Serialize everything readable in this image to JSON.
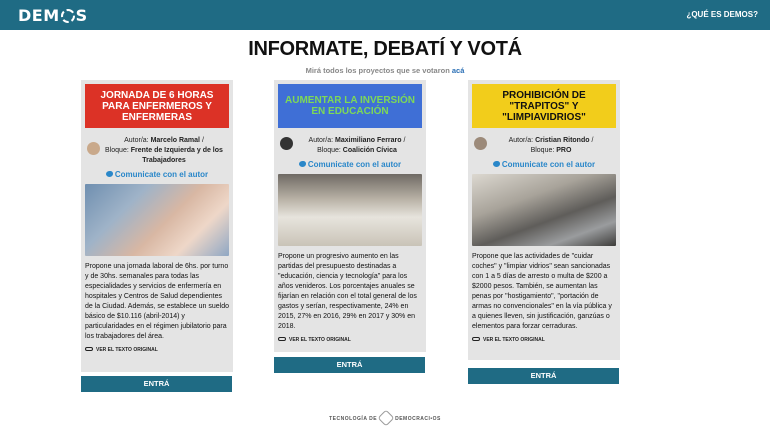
{
  "header": {
    "logo": "DEMOS",
    "logo_parts": [
      "DE",
      "M",
      "S"
    ],
    "whatis": "¿QUÉ ES DEMOS?"
  },
  "headline": "INFORMATE, DEBATÍ Y VOTÁ",
  "subline": {
    "text": "Mirá todos los proyectos que se votaron ",
    "link": "acá"
  },
  "cards": [
    {
      "title": "JORNADA DE 6 HORAS PARA ENFERMEROS Y ENFERMERAS",
      "title_bg": "#dc3226",
      "title_color": "#ffffff",
      "author_prefix": "Autor/a: ",
      "author_name": "Marcelo Ramal",
      "bloc_prefix": "Bloque: ",
      "bloc_name": "Frente de Izquierda y de los Trabajadores",
      "contact": "Comunicate con el autor",
      "description": "Propone una jornada laboral de 6hs. por turno y de 30hs. semanales para todas las especialidades y servicios de enfermería en hospitales y Centros de Salud dependientes de la Ciudad. Además, se establece un sueldo básico de $10.116 (abril-2014) y particularidades en el régimen jubilatorio para los trabajadores del área.",
      "original": "VER EL TEXTO ORIGINAL",
      "button": "ENTRÁ"
    },
    {
      "title": "AUMENTAR LA INVERSIÓN EN EDUCACIÓN",
      "title_bg": "#3f6fd6",
      "title_color": "#7ed957",
      "author_prefix": "Autor/a: ",
      "author_name": "Maximiliano Ferraro",
      "bloc_prefix": "Bloque: ",
      "bloc_name": "Coalición Cívica",
      "contact": "Comunicate con el autor",
      "description": "Propone un progresivo aumento en las partidas del presupuesto destinadas a \"educación, ciencia y tecnología\" para los años venideros. Los porcentajes anuales se fijarían en relación con el total general de los gastos y serían, respectivamente, 24% en 2015, 27% en 2016, 29% en 2017 y 30% en 2018.",
      "original": "VER EL TEXTO ORIGINAL",
      "button": "ENTRÁ"
    },
    {
      "title": "PROHIBICIÓN DE \"TRAPITOS\" Y \"LIMPIAVIDRIOS\"",
      "title_bg": "#f2cd1b",
      "title_color": "#111111",
      "author_prefix": "Autor/a: ",
      "author_name": "Cristian Ritondo",
      "bloc_prefix": "Bloque: ",
      "bloc_name": "PRO",
      "contact": "Comunicate con el autor",
      "description": "Propone que las actividades de \"cuidar coches\" y \"limpiar vidrios\" sean sancionadas con 1 a 5 días de arresto o multa de $200 a $2000 pesos. También, se aumentan las penas por \"hostigamiento\", \"portación de armas no convencionales\" en la vía pública y a quienes lleven, sin justificación, ganzúas o elementos para forzar cerraduras.",
      "original": "VER EL TEXTO ORIGINAL",
      "button": "ENTRÁ"
    }
  ],
  "footer": {
    "left": "TECNOLOGÍA DE",
    "right": "DEMOCRACI•OS"
  }
}
